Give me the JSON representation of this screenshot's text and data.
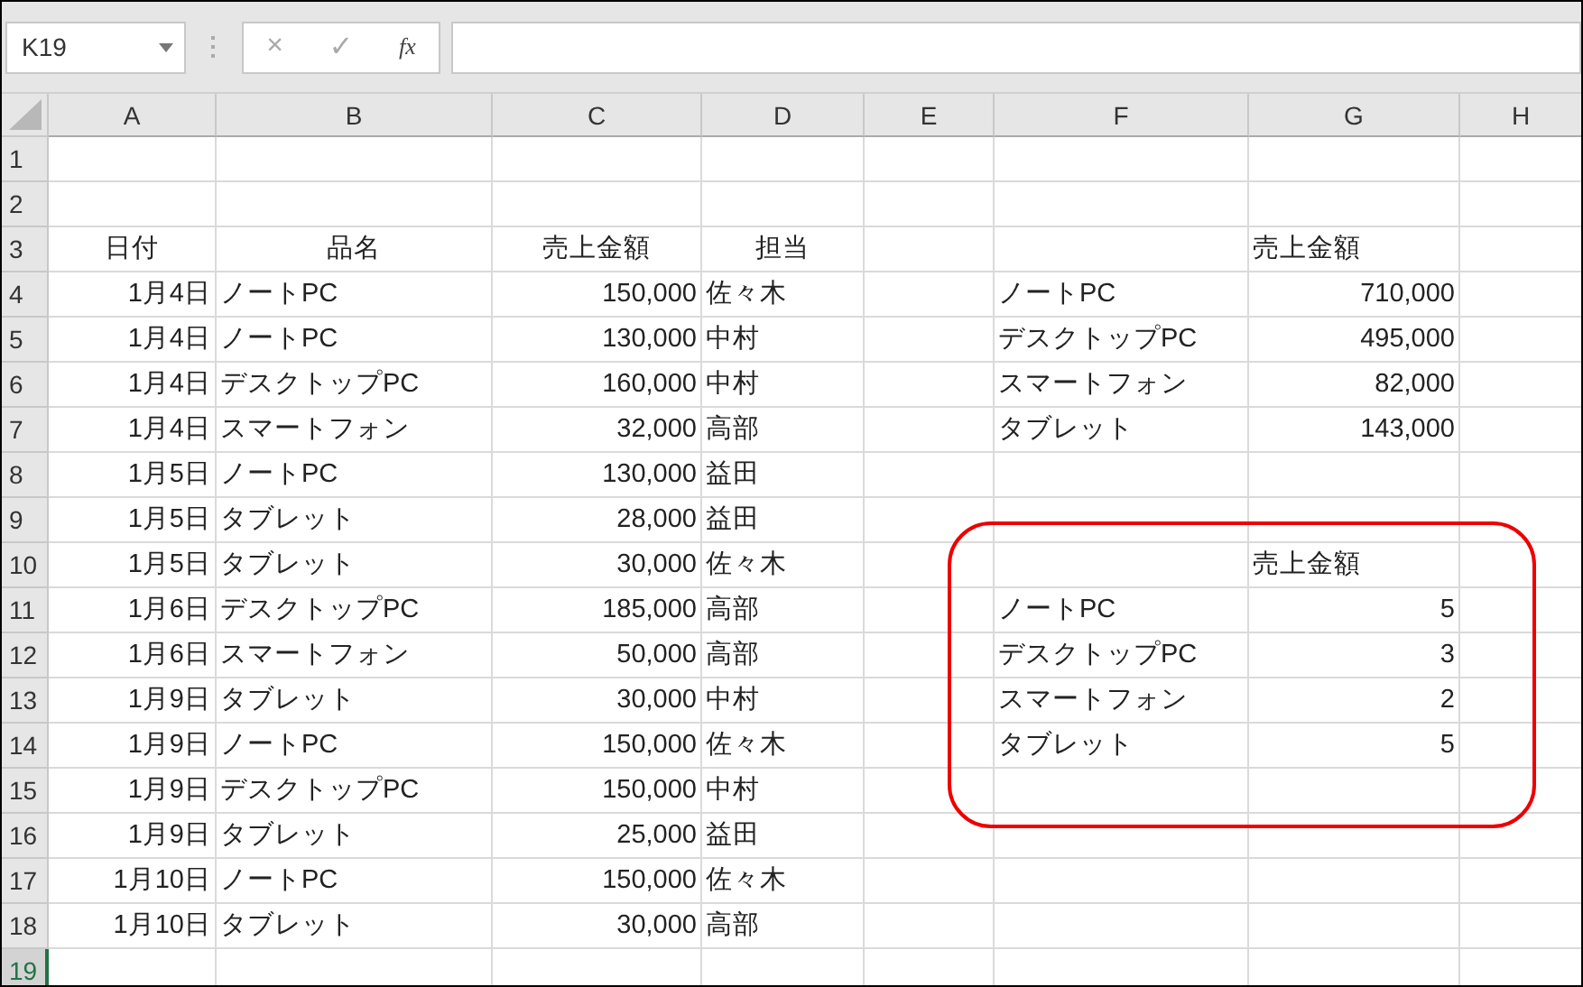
{
  "name_box": {
    "value": "K19"
  },
  "formula_bar": {
    "cancel": "×",
    "enter": "✓",
    "function": "fx"
  },
  "columns": [
    "A",
    "B",
    "C",
    "D",
    "E",
    "F",
    "G",
    "H"
  ],
  "rows": [
    {
      "number": "1",
      "selected": false,
      "cells": {}
    },
    {
      "number": "2",
      "selected": false,
      "cells": {}
    },
    {
      "number": "3",
      "selected": false,
      "cells": {
        "A": {
          "text": "日付",
          "kind": "heading"
        },
        "B": {
          "text": "品名",
          "kind": "heading"
        },
        "C": {
          "text": "売上金額",
          "kind": "heading"
        },
        "D": {
          "text": "担当",
          "kind": "heading"
        },
        "G": {
          "text": "売上金額",
          "kind": "text"
        }
      }
    },
    {
      "number": "4",
      "selected": false,
      "cells": {
        "A": {
          "text": "1月4日",
          "kind": "number"
        },
        "B": {
          "text": "ノートPC",
          "kind": "text"
        },
        "C": {
          "text": "150,000",
          "kind": "number"
        },
        "D": {
          "text": "佐々木",
          "kind": "text"
        },
        "F": {
          "text": "ノートPC",
          "kind": "text"
        },
        "G": {
          "text": "710,000",
          "kind": "number"
        }
      }
    },
    {
      "number": "5",
      "selected": false,
      "cells": {
        "A": {
          "text": "1月4日",
          "kind": "number"
        },
        "B": {
          "text": "ノートPC",
          "kind": "text"
        },
        "C": {
          "text": "130,000",
          "kind": "number"
        },
        "D": {
          "text": "中村",
          "kind": "text"
        },
        "F": {
          "text": "デスクトップPC",
          "kind": "text"
        },
        "G": {
          "text": "495,000",
          "kind": "number"
        }
      }
    },
    {
      "number": "6",
      "selected": false,
      "cells": {
        "A": {
          "text": "1月4日",
          "kind": "number"
        },
        "B": {
          "text": "デスクトップPC",
          "kind": "text"
        },
        "C": {
          "text": "160,000",
          "kind": "number"
        },
        "D": {
          "text": "中村",
          "kind": "text"
        },
        "F": {
          "text": "スマートフォン",
          "kind": "text"
        },
        "G": {
          "text": "82,000",
          "kind": "number"
        }
      }
    },
    {
      "number": "7",
      "selected": false,
      "cells": {
        "A": {
          "text": "1月4日",
          "kind": "number"
        },
        "B": {
          "text": "スマートフォン",
          "kind": "text"
        },
        "C": {
          "text": "32,000",
          "kind": "number"
        },
        "D": {
          "text": "高部",
          "kind": "text"
        },
        "F": {
          "text": "タブレット",
          "kind": "text"
        },
        "G": {
          "text": "143,000",
          "kind": "number"
        }
      }
    },
    {
      "number": "8",
      "selected": false,
      "cells": {
        "A": {
          "text": "1月5日",
          "kind": "number"
        },
        "B": {
          "text": "ノートPC",
          "kind": "text"
        },
        "C": {
          "text": "130,000",
          "kind": "number"
        },
        "D": {
          "text": "益田",
          "kind": "text"
        }
      }
    },
    {
      "number": "9",
      "selected": false,
      "cells": {
        "A": {
          "text": "1月5日",
          "kind": "number"
        },
        "B": {
          "text": "タブレット",
          "kind": "text"
        },
        "C": {
          "text": "28,000",
          "kind": "number"
        },
        "D": {
          "text": "益田",
          "kind": "text"
        }
      }
    },
    {
      "number": "10",
      "selected": false,
      "cells": {
        "A": {
          "text": "1月5日",
          "kind": "number"
        },
        "B": {
          "text": "タブレット",
          "kind": "text"
        },
        "C": {
          "text": "30,000",
          "kind": "number"
        },
        "D": {
          "text": "佐々木",
          "kind": "text"
        },
        "G": {
          "text": "売上金額",
          "kind": "text"
        }
      }
    },
    {
      "number": "11",
      "selected": false,
      "cells": {
        "A": {
          "text": "1月6日",
          "kind": "number"
        },
        "B": {
          "text": "デスクトップPC",
          "kind": "text"
        },
        "C": {
          "text": "185,000",
          "kind": "number"
        },
        "D": {
          "text": "高部",
          "kind": "text"
        },
        "F": {
          "text": "ノートPC",
          "kind": "text"
        },
        "G": {
          "text": "5",
          "kind": "number"
        }
      }
    },
    {
      "number": "12",
      "selected": false,
      "cells": {
        "A": {
          "text": "1月6日",
          "kind": "number"
        },
        "B": {
          "text": "スマートフォン",
          "kind": "text"
        },
        "C": {
          "text": "50,000",
          "kind": "number"
        },
        "D": {
          "text": "高部",
          "kind": "text"
        },
        "F": {
          "text": "デスクトップPC",
          "kind": "text"
        },
        "G": {
          "text": "3",
          "kind": "number"
        }
      }
    },
    {
      "number": "13",
      "selected": false,
      "cells": {
        "A": {
          "text": "1月9日",
          "kind": "number"
        },
        "B": {
          "text": "タブレット",
          "kind": "text"
        },
        "C": {
          "text": "30,000",
          "kind": "number"
        },
        "D": {
          "text": "中村",
          "kind": "text"
        },
        "F": {
          "text": "スマートフォン",
          "kind": "text"
        },
        "G": {
          "text": "2",
          "kind": "number"
        }
      }
    },
    {
      "number": "14",
      "selected": false,
      "cells": {
        "A": {
          "text": "1月9日",
          "kind": "number"
        },
        "B": {
          "text": "ノートPC",
          "kind": "text"
        },
        "C": {
          "text": "150,000",
          "kind": "number"
        },
        "D": {
          "text": "佐々木",
          "kind": "text"
        },
        "F": {
          "text": "タブレット",
          "kind": "text"
        },
        "G": {
          "text": "5",
          "kind": "number"
        }
      }
    },
    {
      "number": "15",
      "selected": false,
      "cells": {
        "A": {
          "text": "1月9日",
          "kind": "number"
        },
        "B": {
          "text": "デスクトップPC",
          "kind": "text"
        },
        "C": {
          "text": "150,000",
          "kind": "number"
        },
        "D": {
          "text": "中村",
          "kind": "text"
        }
      }
    },
    {
      "number": "16",
      "selected": false,
      "cells": {
        "A": {
          "text": "1月9日",
          "kind": "number"
        },
        "B": {
          "text": "タブレット",
          "kind": "text"
        },
        "C": {
          "text": "25,000",
          "kind": "number"
        },
        "D": {
          "text": "益田",
          "kind": "text"
        }
      }
    },
    {
      "number": "17",
      "selected": false,
      "cells": {
        "A": {
          "text": "1月10日",
          "kind": "number"
        },
        "B": {
          "text": "ノートPC",
          "kind": "text"
        },
        "C": {
          "text": "150,000",
          "kind": "number"
        },
        "D": {
          "text": "佐々木",
          "kind": "text"
        }
      }
    },
    {
      "number": "18",
      "selected": false,
      "cells": {
        "A": {
          "text": "1月10日",
          "kind": "number"
        },
        "B": {
          "text": "タブレット",
          "kind": "text"
        },
        "C": {
          "text": "30,000",
          "kind": "number"
        },
        "D": {
          "text": "高部",
          "kind": "text"
        }
      }
    },
    {
      "number": "19",
      "selected": true,
      "cells": {}
    }
  ]
}
